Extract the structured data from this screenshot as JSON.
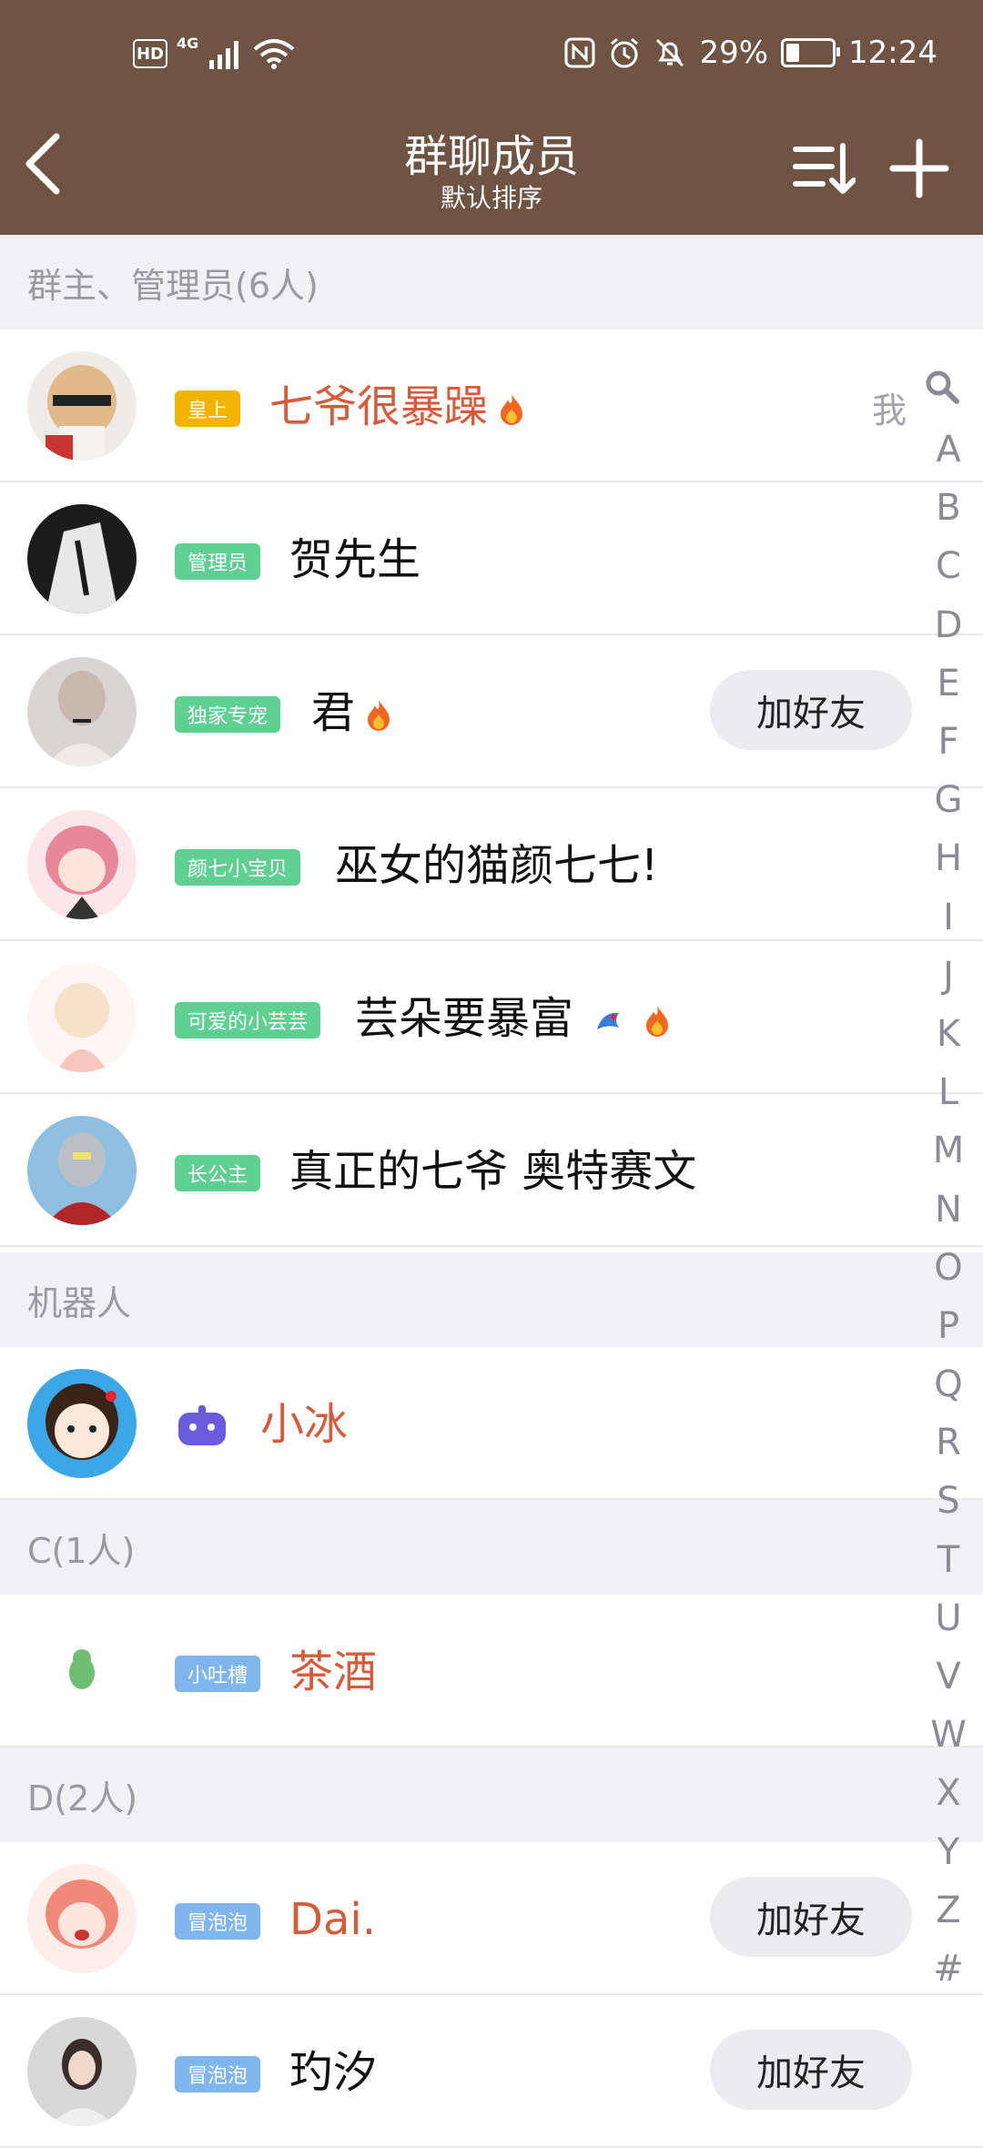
{
  "status_bar": {
    "hd": "HD",
    "network": "4G",
    "battery": "29%",
    "battery_level": 0.29,
    "time": "12:24"
  },
  "header": {
    "title": "群聊成员",
    "subtitle": "默认排序"
  },
  "sections": [
    {
      "title": "群主、管理员(6人)",
      "members": [
        {
          "tag": "皇上",
          "tag_color": "#f3b400",
          "name": "七爷很暴躁",
          "name_color": "#d75a3b",
          "fire": true,
          "right": "我"
        },
        {
          "tag": "管理员",
          "tag_color": "#5fcf92",
          "name": "贺先生",
          "name_color": "#111111"
        },
        {
          "tag": "独家专宠",
          "tag_color": "#5fcf92",
          "name": "君",
          "name_color": "#111111",
          "fire": true,
          "action": "加好友"
        },
        {
          "tag": "颜七小宝贝",
          "tag_color": "#5fcf92",
          "name": "巫女的猫颜七七!",
          "name_color": "#111111"
        },
        {
          "tag": "可爱的小芸芸",
          "tag_color": "#5fcf92",
          "name": "芸朵要暴富",
          "name_color": "#111111",
          "fire": true
        },
        {
          "tag": "长公主",
          "tag_color": "#5fcf92",
          "name": "真正的七爷 奥特赛文",
          "name_color": "#111111"
        }
      ]
    },
    {
      "title": "机器人",
      "members": [
        {
          "name": "小冰",
          "name_color": "#d75a3b"
        }
      ]
    },
    {
      "title": "C(1人)",
      "members": [
        {
          "tag": "小吐槽",
          "tag_color": "#7fb6ee",
          "name": "茶酒",
          "name_color": "#d75a3b"
        }
      ]
    },
    {
      "title": "D(2人)",
      "members": [
        {
          "tag": "冒泡泡",
          "tag_color": "#7fb6ee",
          "name": "Dai.",
          "name_color": "#d75a3b",
          "action": "加好友"
        },
        {
          "tag": "冒泡泡",
          "tag_color": "#7fb6ee",
          "name": "玓汐",
          "name_color": "#111111",
          "action": "加好友"
        }
      ]
    }
  ],
  "index_letters": [
    "A",
    "B",
    "C",
    "D",
    "E",
    "F",
    "G",
    "H",
    "I",
    "J",
    "K",
    "L",
    "M",
    "N",
    "O",
    "P",
    "Q",
    "R",
    "S",
    "T",
    "U",
    "V",
    "W",
    "X",
    "Y",
    "Z",
    "#"
  ]
}
